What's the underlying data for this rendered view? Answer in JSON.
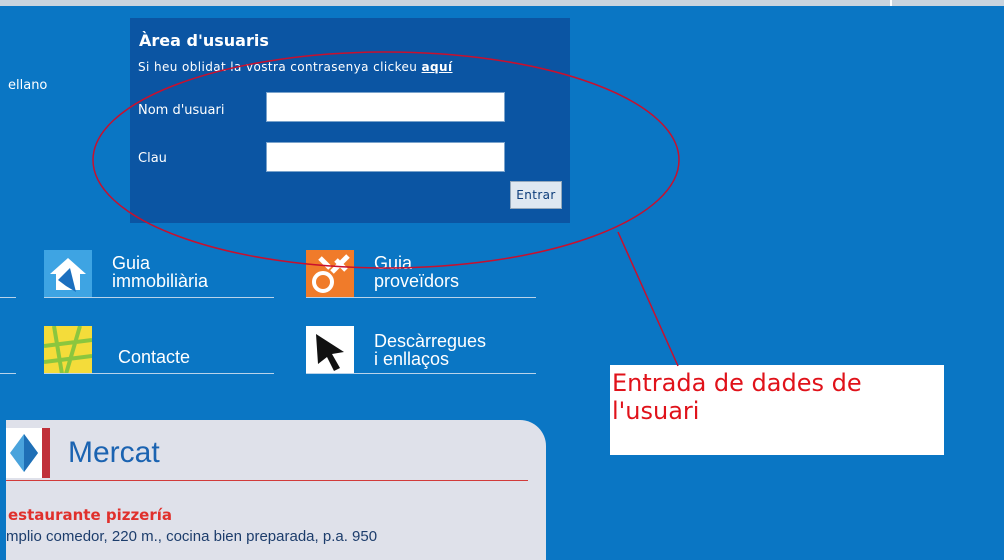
{
  "language_link": "ellano",
  "login": {
    "title": "Àrea d'usuaris",
    "forgot_text": "Si heu oblidat la vostra contrasenya clickeu",
    "forgot_link": "aquí",
    "username_label": "Nom d'usuari",
    "username_value": "",
    "password_label": "Clau",
    "password_value": "",
    "submit_label": "Entrar"
  },
  "nav": {
    "guia_immo_line1": "Guia",
    "guia_immo_line2": "immobiliària",
    "guia_prov_line1": "Guia",
    "guia_prov_line2": "proveïdors",
    "contacte": "Contacte",
    "desc_line1": "Descàrregues",
    "desc_line2": "i enllaços"
  },
  "annotation": {
    "line1": "Entrada de dades de",
    "line2": "l'usuari",
    "color": "#e0121a"
  },
  "mercat": {
    "title": "Mercat",
    "listing_title": "estaurante pizzería",
    "listing_desc": "mplio comedor, 220 m., cocina bien preparada, p.a. 950"
  },
  "colors": {
    "page_bg": "#0a76c4",
    "login_bg": "#0b55a3",
    "mercat_bg": "#dfe1ea"
  }
}
